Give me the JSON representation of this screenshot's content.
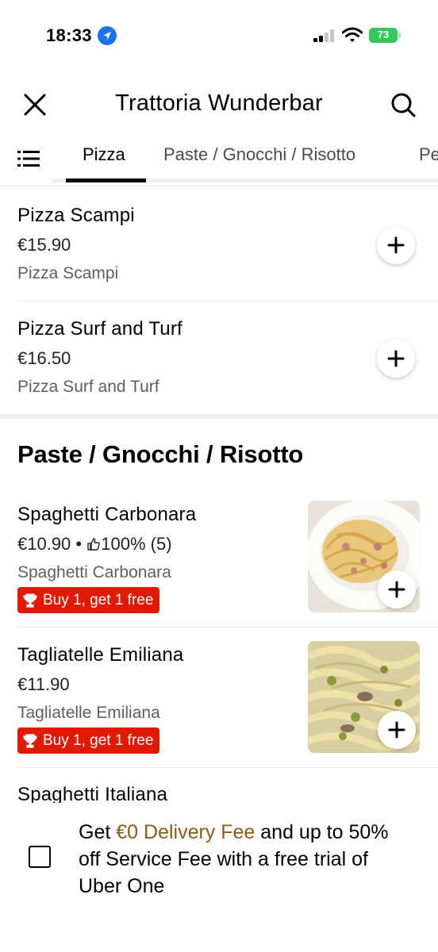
{
  "status_bar": {
    "time": "18:33",
    "battery": "73",
    "location_icon": "location-arrow-icon",
    "signal_icon": "cellular-signal-icon",
    "wifi_icon": "wifi-icon"
  },
  "header": {
    "title": "Trattoria Wunderbar",
    "close_icon": "close-icon",
    "search_icon": "search-icon"
  },
  "tabs": {
    "menu_icon": "list-menu-icon",
    "items": [
      {
        "label": "Pizza",
        "active": true
      },
      {
        "label": "Paste / Gnocchi / Risotto",
        "active": false
      },
      {
        "label": "Pe",
        "active": false
      }
    ]
  },
  "pizza_items": [
    {
      "name": "Pizza Scampi",
      "price": "€15.90",
      "description": "Pizza Scampi"
    },
    {
      "name": "Pizza Surf and Turf",
      "price": "€16.50",
      "description": "Pizza Surf and Turf"
    }
  ],
  "pasta_section": {
    "title": "Paste / Gnocchi / Risotto",
    "items": [
      {
        "name": "Spaghetti Carbonara",
        "price": "€10.90",
        "separator": "•",
        "rating": "100% (5)",
        "description": "Spaghetti Carbonara",
        "promo": "Buy 1, get 1 free"
      },
      {
        "name": "Tagliatelle Emiliana",
        "price": "€11.90",
        "description": "Tagliatelle Emiliana",
        "promo": "Buy 1, get 1 free"
      },
      {
        "name": "Spaghetti Italiana"
      }
    ]
  },
  "promo_banner": {
    "prefix": "Get ",
    "highlight": "€0 Delivery Fee",
    "suffix": " and up to 50% off Service Fee with a free trial of Uber One"
  },
  "colors": {
    "promo_red": "#e11900",
    "highlight_brown": "#8a5b1d",
    "battery_green": "#34c759",
    "location_blue": "#1a73e8"
  }
}
